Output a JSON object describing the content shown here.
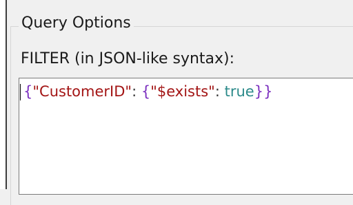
{
  "group": {
    "title": "Query Options"
  },
  "filter": {
    "label": "FILTER (in JSON-like syntax):",
    "tokens": [
      {
        "text": "{",
        "kind": "brace"
      },
      {
        "text": "\"CustomerID\"",
        "kind": "key"
      },
      {
        "text": ": ",
        "kind": "punct"
      },
      {
        "text": "{",
        "kind": "brace"
      },
      {
        "text": "\"$exists\"",
        "kind": "key"
      },
      {
        "text": ": ",
        "kind": "punct"
      },
      {
        "text": "true",
        "kind": "bool"
      },
      {
        "text": "}}",
        "kind": "brace"
      }
    ]
  },
  "colors": {
    "brace": "#7b2fbf",
    "key": "#a31515",
    "punct": "#333333",
    "bool": "#2b8a8a"
  }
}
